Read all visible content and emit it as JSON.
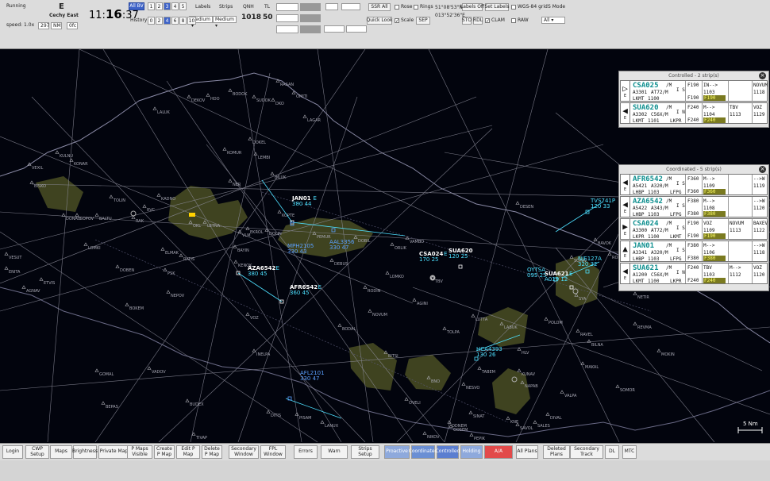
{
  "topbar": {
    "status": "Running",
    "sector_letter": "E",
    "sector_name": "Cechy East",
    "speed": "speed: 1.0x",
    "field_297": "297",
    "field_nm": "NM",
    "field_0fc": "0fc",
    "clock_h": "11",
    "clock_m": "16",
    "clock_s": "37",
    "altitude_filter": "All BV",
    "history_label": "History",
    "range_row1": [
      "1",
      "2",
      "3",
      "4",
      "5"
    ],
    "range_row2": [
      "0",
      "2",
      "4",
      "6",
      "8",
      "10"
    ],
    "labels_label": "Labels",
    "labels_value": "Medium",
    "strips_label": "Strips",
    "strips_value": "Medium",
    "qnh_label": "QNH",
    "qnh_value": "1018",
    "tl_label": "TL",
    "tl_value": "50",
    "ssr_all": "SSR All",
    "quick_look": "Quick Look",
    "rose": "Rose",
    "rings": "Rings",
    "scale": "Scale",
    "sep": "SEP",
    "coord_lat": "51°08'53\"N",
    "coord_lon": "013°52'36\"E",
    "labels_off": "Labels Off",
    "set_labels": "Set Labels",
    "wgs_grid": "WGS-84 grid",
    "s_mode": "S Mode",
    "s_mode_value": "All",
    "sto": "STO",
    "rdl": "RDL",
    "clam": "CLAM",
    "raw": "RAW"
  },
  "bottombar": {
    "buttons": [
      "Login",
      "CWP Setup",
      "Maps",
      "Brightness",
      "Private Maps",
      "P Maps Visible",
      "Create P Map",
      "Edit P Map",
      "Delete P Map",
      "Secondary Window",
      "FPL Window",
      "Errors",
      "Warn",
      "Strips Setup",
      "Proactive",
      "Coordinated",
      "Controlled",
      "Holding",
      "A/A",
      "All Plans",
      "Deleted Plans",
      "Secondary Track",
      "DL",
      "MTC"
    ]
  },
  "controlled_panel": {
    "title": "Controlled - 2 strip(s)",
    "strips": [
      {
        "arrow": "▷",
        "letter": "E",
        "callsign": "CSA025",
        "wt": "/M",
        "type": "A3301",
        "ac": "AT72/M",
        "dep": "LKMT",
        "code": "1100",
        "is": "I S",
        "fl1": "F190",
        "fl2": "F190",
        "route": "IN-->",
        "sq": "1103",
        "pt": "NOVUM",
        "t1": "1118",
        "bar": "F190"
      },
      {
        "arrow": "◀",
        "letter": "E",
        "callsign": "SUA620",
        "wt": "/M",
        "type": "A3302",
        "ac": "C56X/M",
        "dep": "LKMT",
        "code": "1101",
        "is": "I N",
        "fl1": "F240",
        "fl2": "F240",
        "route": "M-->",
        "sq": "1104",
        "pt": "VOZ",
        "t1": "1129",
        "pt0": "TBV",
        "t0": "1113",
        "dest": "LKPR",
        "bar": "F240"
      }
    ]
  },
  "coordinated_panel": {
    "title": "Coordinated - 5 strip(s)",
    "strips": [
      {
        "arrow": "◀",
        "letter": "E",
        "callsign": "AFR6542",
        "wt": "/M",
        "type": "A5421",
        "ac": "A320/M",
        "dep": "LHBP",
        "code": "1103",
        "is": "I S",
        "fl1": "F360",
        "fl2": "F360",
        "route": "M-->",
        "sq": "1109",
        "pt": "-->W",
        "t1": "1119",
        "dest": "LFPG",
        "bar": "F360"
      },
      {
        "arrow": "◀",
        "letter": "E",
        "callsign": "AZA6542",
        "wt": "/M",
        "type": "A5422",
        "ac": "A343/M",
        "dep": "LHBP",
        "code": "1103",
        "is": "I S",
        "fl1": "F380",
        "fl2": "F380",
        "route": "M-->",
        "sq": "1108",
        "pt": "-->W",
        "t1": "1120",
        "dest": "LFPG",
        "bar": "F380"
      },
      {
        "arrow": "▶",
        "letter": "E",
        "callsign": "CSA024",
        "wt": "/M",
        "type": "A3300",
        "ac": "AT72/M",
        "dep": "LKPR",
        "code": "1100",
        "is": "I S",
        "fl1": "F190",
        "fl2": "F190",
        "route": "VOZ",
        "sq": "1109",
        "pt": "BAXEV",
        "t1": "1122",
        "pt0": "NOVUM",
        "t0": "1113",
        "dest": "LKMT",
        "bar": "F190"
      },
      {
        "arrow": "▲",
        "letter": "E",
        "callsign": "JAN01",
        "wt": "/M",
        "type": "A3341",
        "ac": "A320/M",
        "dep": "LHBP",
        "code": "1103",
        "is": "I S",
        "fl1": "F380",
        "fl2": "F380",
        "route": "M-->",
        "sq": "1106",
        "pt": "-->W",
        "t1": "1118",
        "dest": "LFPG",
        "bar": "F380"
      },
      {
        "arrow": "◀",
        "letter": "E",
        "callsign": "SUA621",
        "wt": "/M",
        "type": "A1200",
        "ac": "C56X/M",
        "dep": "LKMT",
        "code": "1100",
        "is": "I N",
        "fl1": "F240",
        "fl2": "F240",
        "route": "TBV",
        "sq": "1103",
        "pt": "VOZ",
        "t1": "1120",
        "pt0": "M-->",
        "t0": "1112",
        "dest": "LKPR",
        "bar": "F240"
      }
    ]
  },
  "aircraft": [
    {
      "callsign": "JAN01",
      "line2": "380 44",
      "suffix": "E",
      "color": "#ffffff"
    },
    {
      "callsign": "AZA6542",
      "line2": "380 45",
      "suffix": "E",
      "color": "#ffffff"
    },
    {
      "callsign": "AFR6542",
      "line2": "360 45",
      "suffix": "E",
      "color": "#ffffff"
    },
    {
      "callsign": "MPH2105",
      "line2": "330 43",
      "suffix": "",
      "color": "#5aa0ff"
    },
    {
      "callsign": "AAL3356",
      "line2": "330 47",
      "suffix": "",
      "color": "#5aa0ff"
    },
    {
      "callsign": "CSA024",
      "line2": "170 25",
      "suffix": "E",
      "color": "#ffffff"
    },
    {
      "callsign": "SUA620",
      "line2": "120 25",
      "suffix": "",
      "color": "#ffffff"
    },
    {
      "callsign": "TVS741P",
      "line2": "120 33",
      "suffix": "",
      "color": "#4de0ff"
    },
    {
      "callsign": "NJE127A",
      "line2": "320 32",
      "suffix": "",
      "color": "#4de0ff"
    },
    {
      "callsign": "OYTSA",
      "line2": "095 25",
      "suffix": "",
      "color": "#4de0ff"
    },
    {
      "callsign": "SUA621",
      "line2": "A019 12",
      "suffix": "E",
      "color": "#ffffff"
    },
    {
      "callsign": "HCA4393",
      "line2": "130 26",
      "suffix": "",
      "color": "#4de0ff"
    },
    {
      "callsign": "AFL2101",
      "line2": "330 47",
      "suffix": "",
      "color": "#5aa0ff"
    }
  ],
  "points": [
    "RASAN",
    "LALUK",
    "DEKOV",
    "HDO",
    "BODOK",
    "SUDOK",
    "DKO",
    "LAGAR",
    "OMITI",
    "KOMUR",
    "DOKEL",
    "LEMBI",
    "BILUK",
    "VEXIL",
    "KULNU",
    "KONAR",
    "BISKO",
    "KADNO",
    "RVC",
    "DONAD",
    "GOPOV",
    "BALTU",
    "LETNA",
    "OKL",
    "RAK",
    "VLM",
    "KOPTE",
    "EKROL",
    "DOLIN",
    "PEMUR",
    "DOBIL",
    "ORLIK",
    "VAMBO",
    "DESEN",
    "BAVOK",
    "TBV",
    "RATIS",
    "KENOK",
    "BAYIN",
    "ELMAK",
    "DOBEN",
    "PSK",
    "NEPOV",
    "ETVIS",
    "AGNAV",
    "ENITA",
    "LOMKI",
    "VESUT",
    "BOKEM",
    "VOZ",
    "NOVUM",
    "BODAL",
    "INELPA",
    "LUTTA",
    "LABUK",
    "BITSI",
    "POLOM",
    "RAVEL",
    "BNO",
    "NESVO",
    "HLV",
    "KUNAV",
    "NAPAB",
    "KNE",
    "SALES",
    "SAVOL",
    "MAKAL",
    "VALPA",
    "BILNA",
    "REVMA",
    "NETIR",
    "ROBLE",
    "SOPAV",
    "GOMAL",
    "VADOV",
    "BUDEX",
    "BEPAS",
    "DITIS",
    "PISAM",
    "LANUX",
    "TIVAP",
    "NIKOV",
    "PEPIK",
    "GOSEM",
    "ODNEM",
    "OVELI",
    "SINAT",
    "SYA",
    "NER",
    "TOLIN",
    "DEBUS",
    "RODIN",
    "LOMKO",
    "AGINI",
    "TOLPA",
    "TABEM",
    "DIVAL",
    "SOMOR",
    "MOKIN"
  ],
  "scale_label": "5 Nm",
  "colors": {
    "background": "#02040d",
    "airway": "#8c8c9a",
    "border": "#8a8aa6",
    "tma": "#4a4f25",
    "selected": "#3e63c8",
    "coordinated_btn": "#6b8fd4",
    "controlled_btn": "#5b7ed0",
    "aa_btn": "#e24a4a",
    "strip_callsign": "#0e8f8f",
    "flight_level_bar": "#7a7a20"
  }
}
